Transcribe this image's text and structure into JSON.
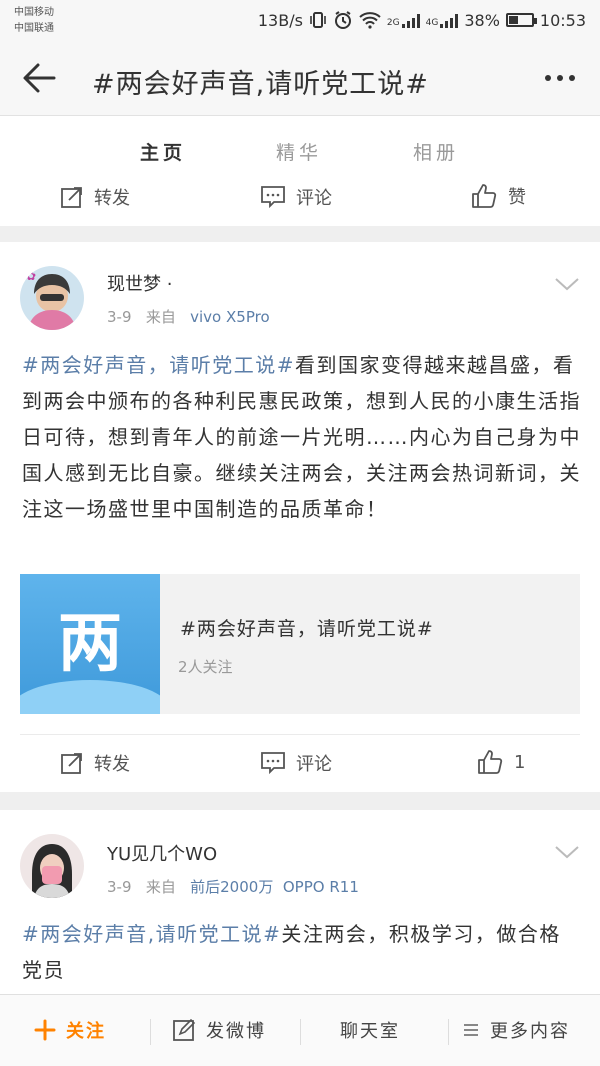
{
  "status_bar": {
    "carrier1": "中国移动",
    "carrier2": "中国联通",
    "speed": "13B/s",
    "net1": "2G",
    "net2": "4G",
    "battery": "38%",
    "time": "10:53"
  },
  "nav": {
    "title": "#两会好声音,请听党工说#"
  },
  "tabs": [
    {
      "label": "主页",
      "active": true
    },
    {
      "label": "精华",
      "active": false
    },
    {
      "label": "相册",
      "active": false
    }
  ],
  "action_labels": {
    "repost": "转发",
    "comment": "评论",
    "like": "赞"
  },
  "posts": [
    {
      "username": "现世梦 ·",
      "date": "3-9",
      "from_label": "来自",
      "source": "vivo X5Pro",
      "content_tag": "#两会好声音，请听党工说#",
      "content_text": "看到国家变得越来越昌盛，看到两会中颁布的各种利民惠民政策，想到人民的小康生活指日可待，想到青年人的前途一片光明……内心为自己身为中国人感到无比自豪。继续关注两会，关注两会热词新词，关注这一场盛世里中国制造的品质革命！",
      "link_thumb_char": "两",
      "link_title": "#两会好声音，请听党工说#",
      "link_subtitle": "2人关注",
      "repost_label": "转发",
      "comment_label": "评论",
      "like_count": "1"
    },
    {
      "username": "YU见几个WO",
      "date": "3-9",
      "from_label": "来自",
      "source_prefix": "前后2000万",
      "source": "OPPO R11",
      "content_tag": "#两会好声音,请听党工说#",
      "content_text": "关注两会，积极学习，做合格党员"
    }
  ],
  "bottom_bar": {
    "follow": "关注",
    "compose": "发微博",
    "chat": "聊天室",
    "more": "更多内容"
  },
  "colors": {
    "accent": "#ff8200",
    "link": "#5b7ea8"
  }
}
